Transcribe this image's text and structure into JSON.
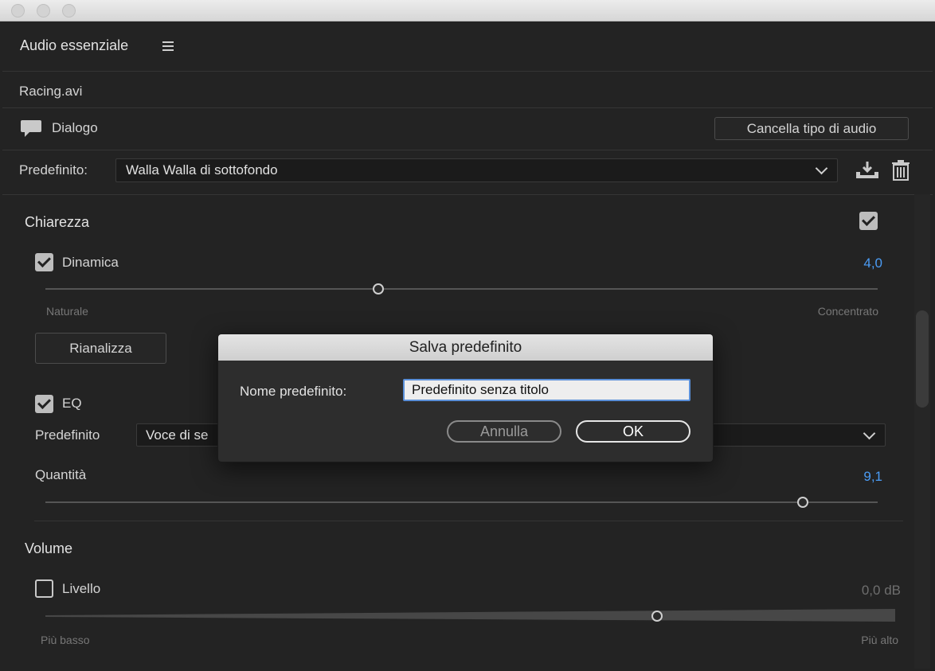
{
  "panel": {
    "title": "Audio essenziale",
    "clip_name": "Racing.avi",
    "audio_type": "Dialogo",
    "clear_type_button": "Cancella tipo di audio",
    "preset_label": "Predefinito:",
    "preset_value": "Walla Walla di sottofondo"
  },
  "clarity": {
    "section_title": "Chiarezza",
    "dynamics_label": "Dinamica",
    "dynamics_value": "4,0",
    "dynamics_level": 0.4,
    "min_label": "Naturale",
    "max_label": "Concentrato",
    "reanalyze_button": "Rianalizza",
    "eq_label": "EQ",
    "eq_preset_label": "Predefinito",
    "eq_preset_value": "Voce di se",
    "amount_label": "Quantità",
    "amount_value": "9,1",
    "amount_level": 0.91
  },
  "volume": {
    "section_title": "Volume",
    "level_label": "Livello",
    "level_value": "0,0 dB",
    "level_position": 0.72,
    "min_label": "Più basso",
    "max_label": "Più alto"
  },
  "dialog": {
    "title": "Salva predefinito",
    "name_label": "Nome predefinito:",
    "name_value": "Predefinito senza titolo",
    "cancel_button": "Annulla",
    "ok_button": "OK"
  },
  "colors": {
    "value_accent": "#4b9cf5",
    "panel_bg": "#232323"
  }
}
